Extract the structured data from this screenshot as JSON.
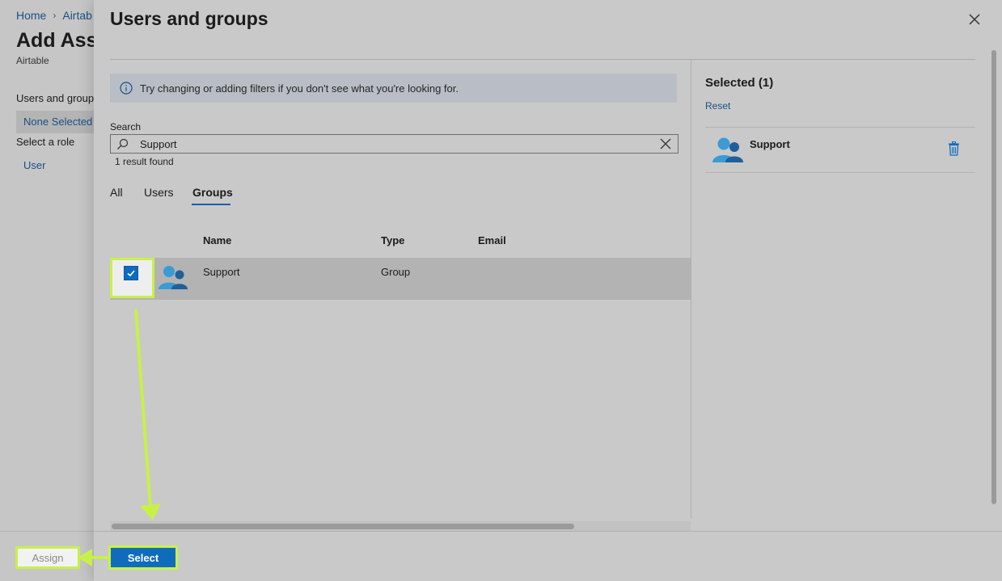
{
  "background": {
    "breadcrumb": {
      "home": "Home",
      "app": "Airtab"
    },
    "title": "Add Assi",
    "subtitle": "Airtable",
    "users_groups_label": "Users and groups",
    "none_selected": "None Selected",
    "select_role_label": "Select a role",
    "role_value": "User",
    "assign_label": "Assign"
  },
  "panel": {
    "title": "Users and groups",
    "info_text": "Try changing or adding filters if you don't see what you're looking for.",
    "search": {
      "label": "Search",
      "value": "Support"
    },
    "result_count": "1 result found",
    "tabs": [
      {
        "label": "All",
        "active": false
      },
      {
        "label": "Users",
        "active": false
      },
      {
        "label": "Groups",
        "active": true
      }
    ],
    "table": {
      "headers": {
        "name": "Name",
        "type": "Type",
        "email": "Email"
      },
      "rows": [
        {
          "name": "Support",
          "type": "Group",
          "email": "",
          "checked": true
        }
      ]
    },
    "selected": {
      "title": "Selected (1)",
      "reset_label": "Reset",
      "items": [
        {
          "name": "Support"
        }
      ]
    },
    "select_label": "Select"
  },
  "colors": {
    "accent": "#0f6cbd",
    "highlight": "#c8f04a",
    "link": "#1a4f86"
  },
  "icons": {
    "info": "info-icon",
    "search": "search-icon",
    "clear": "close-icon",
    "close": "close-icon",
    "group": "group-avatar-icon",
    "delete": "trash-icon"
  }
}
